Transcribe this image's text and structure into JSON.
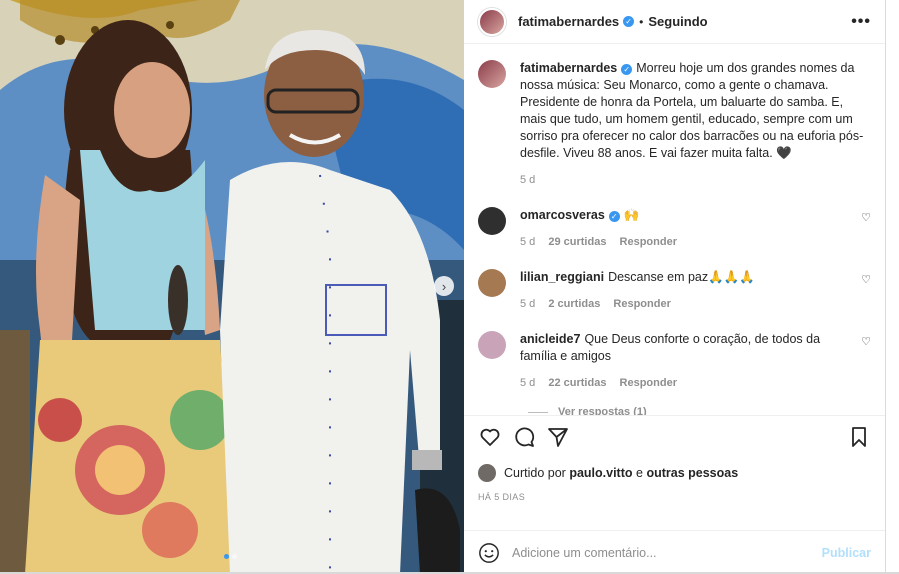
{
  "post": {
    "username": "fatimabernardes",
    "separator": "•",
    "follow_state": "Seguindo",
    "more": "•••"
  },
  "caption": {
    "username": "fatimabernardes",
    "text": "Morreu hoje um dos grandes nomes da nossa música: Seu Monarco, como a gente o chamava. Presidente de honra da Portela, um baluarte do samba. E, mais que tudo, um homem gentil, educado, sempre com um sorriso pra oferecer no calor dos barracões ou na euforia pós-desfile. Viveu 88 anos. E vai fazer muita falta. 🖤",
    "age": "5 d"
  },
  "comments": [
    {
      "username": "omarcosveras",
      "verified": true,
      "text": "🙌",
      "age": "5 d",
      "likes": "29 curtidas",
      "reply": "Responder"
    },
    {
      "username": "lilian_reggiani",
      "verified": false,
      "text": "Descanse em paz🙏🙏🙏",
      "age": "5 d",
      "likes": "2 curtidas",
      "reply": "Responder"
    },
    {
      "username": "anicleide7",
      "verified": false,
      "text": "Que Deus conforte o coração, de todos da família e amigos",
      "age": "5 d",
      "likes": "22 curtidas",
      "reply": "Responder"
    }
  ],
  "view_replies": "Ver respostas (1)",
  "likes": {
    "prefix": "Curtido por",
    "user": "paulo.vitto",
    "conj": "e",
    "others": "outras pessoas"
  },
  "timestamp": "HÁ 5 DIAS",
  "composer": {
    "placeholder": "Adicione um comentário...",
    "post_label": "Publicar"
  },
  "carousel": {
    "total_slides": 2,
    "current_slide": 1
  },
  "colors": {
    "verified": "#3897f0",
    "publish_disabled": "#b2dffc",
    "muted": "#8e8e8e"
  }
}
